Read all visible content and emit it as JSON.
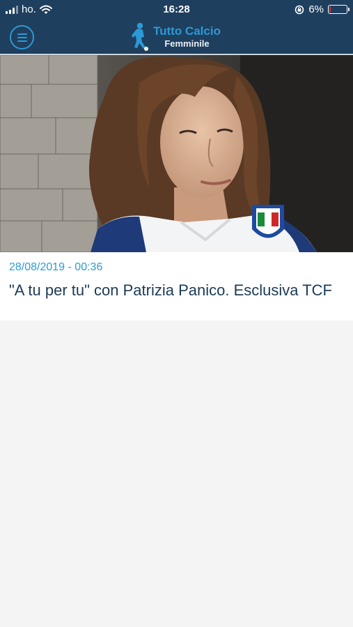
{
  "status_bar": {
    "carrier": "ho.",
    "time": "16:28",
    "battery_percent": "6%",
    "battery_level": 0.06,
    "icons": [
      "signal-icon",
      "wifi-icon",
      "orientation-lock-icon",
      "battery-icon"
    ]
  },
  "header": {
    "logo_title": "Tutto Calcio",
    "logo_subtitle": "Femminile",
    "menu_icon": "hamburger-menu-icon"
  },
  "article": {
    "date": "28/08/2019 - 00:36",
    "title": "\"A tu per tu\" con Patrizia Panico. Esclusiva TCF"
  },
  "colors": {
    "header_bg": "#1f3f5e",
    "accent": "#2b9ad6",
    "headline": "#1b3a56",
    "page_bg": "#f4f4f4"
  }
}
